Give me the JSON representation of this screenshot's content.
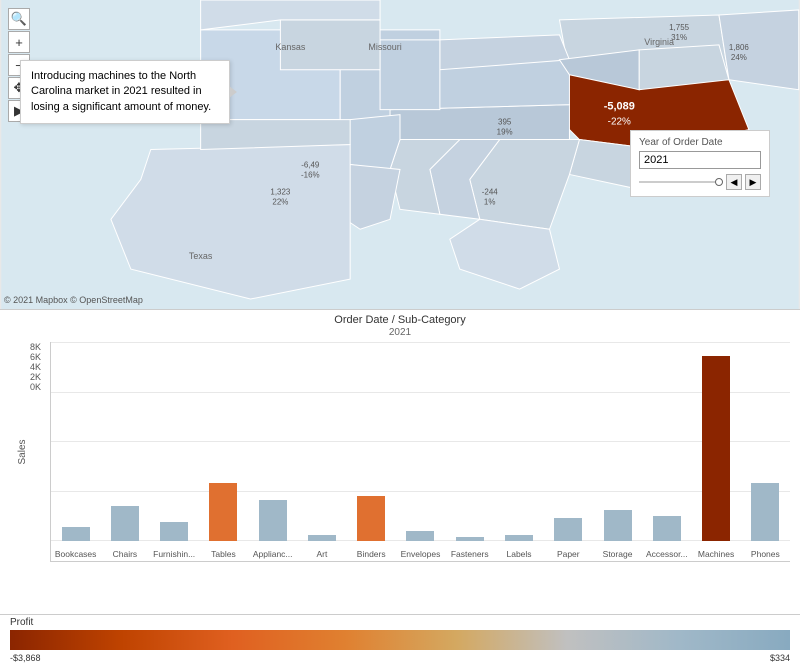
{
  "map": {
    "copyright": "© 2021 Mapbox © OpenStreetMap",
    "tooltip_text": "Introducing machines to the North Carolina market in 2021 resulted in losing a significant amount of money.",
    "nc_value1": "-5,089",
    "nc_value2": "-22%",
    "year_filter_label": "Year of Order Date",
    "year_value": "2021",
    "annotations": [
      {
        "text": "-5,089",
        "sub": "-22%"
      },
      {
        "text": "1,755",
        "sub": "31%"
      },
      {
        "text": "1,806",
        "sub": "24%"
      },
      {
        "text": "395",
        "sub": "19%"
      },
      {
        "text": "-6,49",
        "sub": "-16%"
      },
      {
        "text": "1,323",
        "sub": "22%"
      },
      {
        "text": "-244",
        "sub": "1%"
      }
    ]
  },
  "chart": {
    "title": "Order Date / Sub-Category",
    "subtitle": "2021",
    "y_axis_label": "Sales",
    "y_ticks": [
      "8K",
      "6K",
      "4K",
      "2K",
      "0K"
    ],
    "bars": [
      {
        "label": "Bookcases",
        "height_pct": 7,
        "color": "#a0b8c8"
      },
      {
        "label": "Chairs",
        "height_pct": 18,
        "color": "#a0b8c8"
      },
      {
        "label": "Furnishin...",
        "height_pct": 10,
        "color": "#a0b8c8"
      },
      {
        "label": "Tables",
        "height_pct": 30,
        "color": "#E07030"
      },
      {
        "label": "Applianc...",
        "height_pct": 21,
        "color": "#a0b8c8"
      },
      {
        "label": "Art",
        "height_pct": 3,
        "color": "#a0b8c8"
      },
      {
        "label": "Binders",
        "height_pct": 23,
        "color": "#E07030"
      },
      {
        "label": "Envelopes",
        "height_pct": 5,
        "color": "#a0b8c8"
      },
      {
        "label": "Fasteners",
        "height_pct": 2,
        "color": "#a0b8c8"
      },
      {
        "label": "Labels",
        "height_pct": 3,
        "color": "#a0b8c8"
      },
      {
        "label": "Paper",
        "height_pct": 12,
        "color": "#a0b8c8"
      },
      {
        "label": "Storage",
        "height_pct": 16,
        "color": "#a0b8c8"
      },
      {
        "label": "Accessor...",
        "height_pct": 13,
        "color": "#a0b8c8"
      },
      {
        "label": "Machines",
        "height_pct": 95,
        "color": "#8B2500"
      },
      {
        "label": "Phones",
        "height_pct": 30,
        "color": "#a0b8c8"
      }
    ]
  },
  "profit": {
    "label": "Profit",
    "min_label": "-$3,868",
    "max_label": "$334"
  }
}
